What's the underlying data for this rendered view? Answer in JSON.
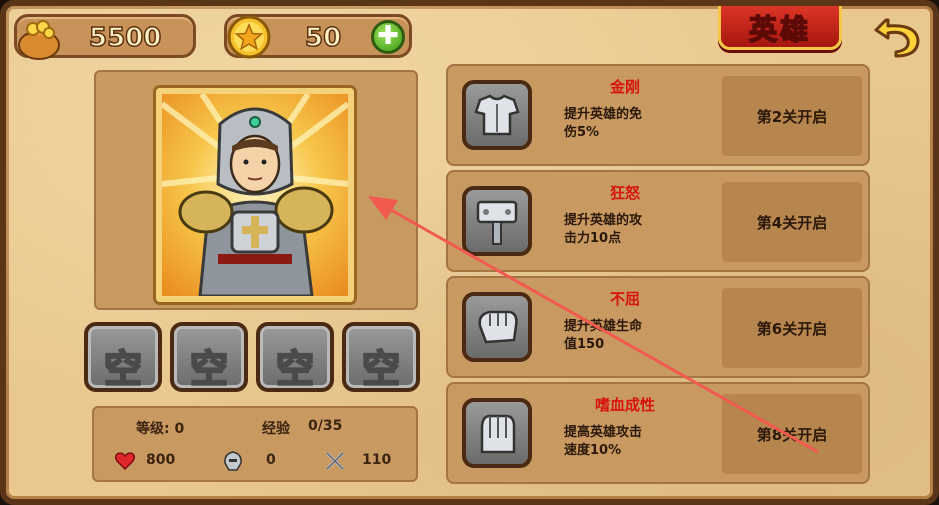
{
  "currency": {
    "gold": "5500",
    "gems": "50",
    "add_symbol": "✚"
  },
  "title": "英雄",
  "stats": {
    "level_label": "等级: 0",
    "exp_label": "经验",
    "exp_value": "0/35",
    "hp": "800",
    "defense": "0",
    "attack": "110"
  },
  "slots": [
    "空",
    "空",
    "空",
    "空"
  ],
  "skills": [
    {
      "name": "金刚",
      "desc_line1": "提升英雄的免",
      "desc_line2": "伤5%",
      "unlock": "第2关开启",
      "icon": "armor-icon"
    },
    {
      "name": "狂怒",
      "desc_line1": "提升英雄的攻",
      "desc_line2": "击力10点",
      "unlock": "第4关开启",
      "icon": "hammer-icon"
    },
    {
      "name": "不屈",
      "desc_line1": "提升英雄生命",
      "desc_line2": "值150",
      "unlock": "第6关开启",
      "icon": "fist-icon"
    },
    {
      "name": "嗜血成性",
      "desc_line1": "提高英雄攻击",
      "desc_line2": "速度10%",
      "unlock": "第8关开启",
      "icon": "gauntlet-icon"
    }
  ],
  "colors": {
    "panel": "#c89a61",
    "skill_name": "#d7140c",
    "banner": "#c9251a",
    "annotation_arrow": "#f05a4f"
  }
}
